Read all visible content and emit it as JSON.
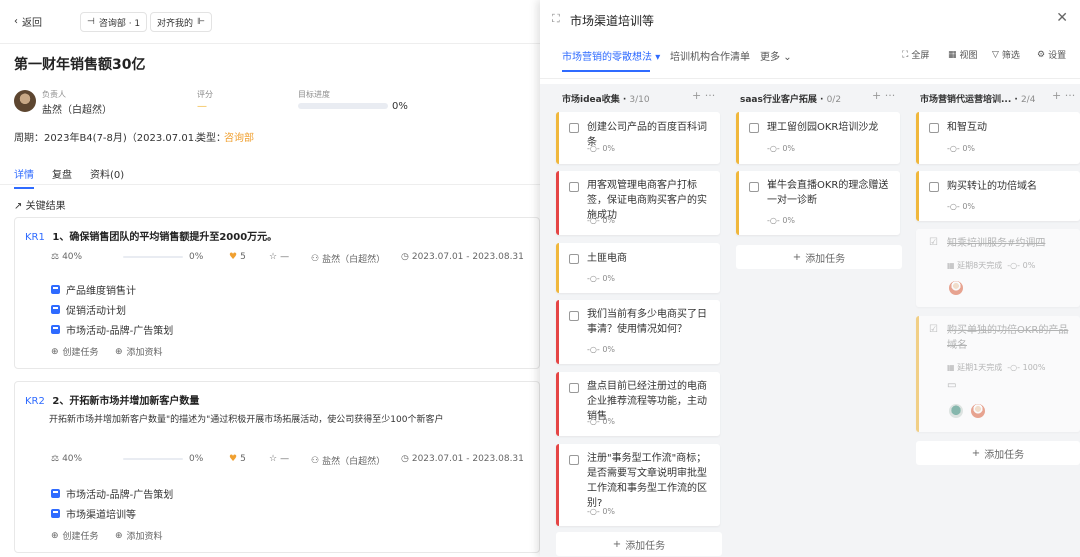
{
  "left": {
    "back": "返回",
    "dept_pill": "咨询部 · 1",
    "align_pill": "对齐我的",
    "title": "第一财年销售额30亿",
    "owner_label": "负责人",
    "owner_name": "盐然（白超然）",
    "rating_label": "评分",
    "rating_value": "—",
    "progress_label": "目标进度",
    "progress_value": "0%",
    "progress_fraction": 0,
    "period": "周期：2023年B4(7-8月)（2023.07.01...",
    "type_label": "类型：",
    "type_value": "咨询部",
    "tabs": [
      "详情",
      "复盘",
      "资料(0)"
    ],
    "section": "关键结果",
    "krs": [
      {
        "code": "KR1",
        "title": "1、确保销售团队的平均销售额提升至2000万元。",
        "weight": "40%",
        "progress": "0%",
        "likes": "5",
        "stars": "—",
        "owner": "盐然（白超然）",
        "dates": "2023.07.01 - 2023.08.31",
        "tasks": [
          "产品维度销售计",
          "促销活动计划",
          "市场活动-品牌-广告策划"
        ],
        "create": "创建任务",
        "add": "添加资料"
      },
      {
        "code": "KR2",
        "title": "2、开拓新市场并增加新客户数量",
        "desc": "开拓新市场并增加新客户数量\"的描述为\"通过积极开展市场拓展活动，使公司获得至少100个新客户",
        "weight": "40%",
        "progress": "0%",
        "likes": "5",
        "stars": "—",
        "owner": "盐然（白超然）",
        "dates": "2023.07.01 - 2023.08.31",
        "tasks": [
          "市场活动-品牌-广告策划",
          "市场渠道培训等"
        ],
        "create": "创建任务",
        "add": "添加资料"
      }
    ]
  },
  "right": {
    "title": "市场渠道培训等",
    "tabs": [
      "市场营销的零散想法",
      "培训机构合作清单",
      "更多"
    ],
    "tools": [
      "全屏",
      "视图",
      "筛选",
      "设置"
    ],
    "add_task": "添加任务",
    "columns": [
      {
        "name": "市场idea收集",
        "count": "3/10",
        "cards": [
          {
            "text": "创建公司产品的百度百科词条",
            "pct": "0%",
            "color": "yellow"
          },
          {
            "text": "用客观管理电商客户打标签，保证电商购买客户的实施成功",
            "pct": "0%",
            "color": "red"
          },
          {
            "text": "土匪电商",
            "pct": "0%",
            "color": "yellow"
          },
          {
            "text": "我们当前有多少电商买了日事清？使用情况如何？",
            "pct": "0%",
            "color": "red"
          },
          {
            "text": "盘点目前已经注册过的电商企业推荐流程等功能，主动销售",
            "pct": "0%",
            "color": "red"
          },
          {
            "text": "注册\"事务型工作流\"商标；是否需要写文章说明审批型工作流和事务型工作流的区别?",
            "pct": "0%",
            "color": "red"
          }
        ]
      },
      {
        "name": "saas行业客户拓展",
        "count": "0/2",
        "cards": [
          {
            "text": "理工留创园OKR培训沙龙",
            "pct": "0%",
            "color": "yellow"
          },
          {
            "text": "崔牛会直播OKR的理念赠送一对一诊断",
            "pct": "0%",
            "color": "yellow"
          }
        ]
      },
      {
        "name": "市场营销代运营培训...",
        "count": "2/4",
        "cards": [
          {
            "text": "和智互动",
            "pct": "0%",
            "color": "yellow"
          },
          {
            "text": "购买转让的功倍域名",
            "pct": "0%",
            "color": "yellow"
          },
          {
            "text": "知乘培训服务#约调四",
            "delay": "延期8天完成",
            "pct": "0%",
            "done": true
          },
          {
            "text": "购买单独的功倍OKR的产品域名",
            "delay": "延期1天完成",
            "pct": "100%",
            "done": true
          }
        ]
      }
    ]
  }
}
